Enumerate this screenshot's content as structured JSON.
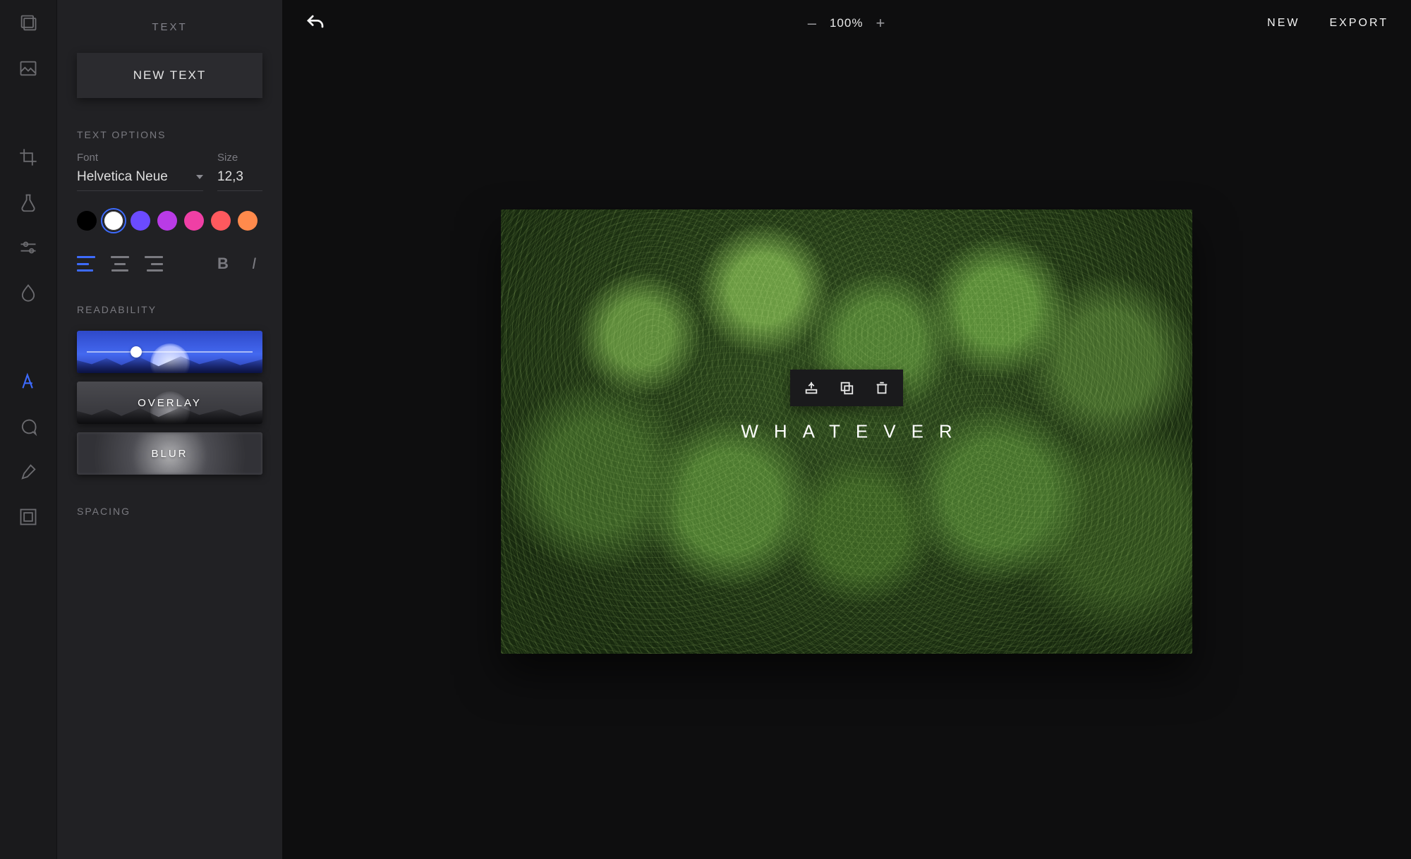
{
  "panel": {
    "title": "TEXT",
    "new_text_button": "NEW TEXT",
    "sections": {
      "text_options": "TEXT OPTIONS",
      "readability": "READABILITY",
      "spacing": "SPACING"
    },
    "font": {
      "label": "Font",
      "value": "Helvetica Neue"
    },
    "size": {
      "label": "Size",
      "value": "12,3"
    },
    "colors": [
      {
        "hex": "#000000",
        "selected": false
      },
      {
        "hex": "#ffffff",
        "selected": true
      },
      {
        "hex": "#6b4bff",
        "selected": false
      },
      {
        "hex": "#b93be6",
        "selected": false
      },
      {
        "hex": "#ef3fa5",
        "selected": false
      },
      {
        "hex": "#ff595e",
        "selected": false
      },
      {
        "hex": "#ff8a4c",
        "selected": false
      }
    ],
    "alignment": "left",
    "readability_cards": {
      "overlay": "OVERLAY",
      "blur": "BLUR"
    }
  },
  "toolbar_icons": [
    "photos-icon",
    "image-icon",
    "crop-icon",
    "flask-icon",
    "sliders-icon",
    "droplet-icon",
    "text-icon",
    "chat-icon",
    "brush-icon",
    "frame-icon"
  ],
  "topbar": {
    "zoom": "100%",
    "new": "NEW",
    "export": "EXPORT"
  },
  "canvas": {
    "text": "WHATEVER"
  }
}
